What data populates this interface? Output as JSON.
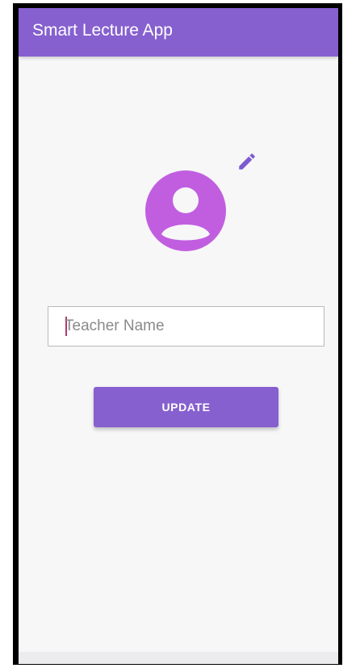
{
  "app_bar": {
    "title": "Smart Lecture App",
    "color": "#8660cf"
  },
  "profile": {
    "avatar_icon": "account-circle-icon",
    "avatar_color": "#c15ee0",
    "edit_icon": "pencil-icon",
    "edit_icon_color": "#7c5ad1"
  },
  "form": {
    "teacher_name": {
      "value": "",
      "placeholder": "Teacher Name"
    },
    "update_button_label": "UPDATE",
    "button_color": "#8660cf"
  }
}
